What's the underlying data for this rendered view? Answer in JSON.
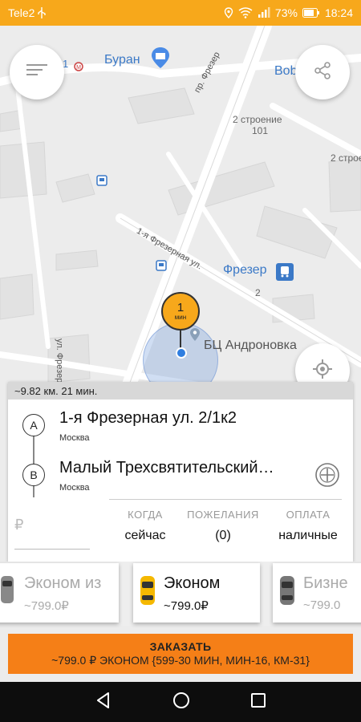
{
  "status": {
    "carrier": "Tele2",
    "battery": "73%",
    "time": "18:24"
  },
  "map": {
    "poi_buran": "Буран",
    "poi_1": "1",
    "poi_bob": "Bob",
    "street_frezer_ave": "пр. Фрезер",
    "building_2_101_line1": "2 строение",
    "building_2_101_line2": "101",
    "building_2_right": "2 строе",
    "street_1st_frezernaya": "1-я Фрезерная ул.",
    "poi_frezer_station": "Фрезер",
    "number_2": "2",
    "street_left": "ул. Фрезер",
    "poi_bc": "БЦ Андроновка",
    "time_marker_value": "1",
    "time_marker_unit": "мин"
  },
  "panel": {
    "route_info": "~9.82 км. 21 мин.",
    "from_letter": "A",
    "from_address": "1-я Фрезерная ул. 2/1к2",
    "from_city": "Москва",
    "to_letter": "B",
    "to_address": "Малый Трехсвятительский…",
    "to_city": "Москва",
    "currency": "₽",
    "when_label": "КОГДА",
    "when_value": "сейчас",
    "wishes_label": "ПОЖЕЛАНИЯ",
    "wishes_value": "(0)",
    "payment_label": "ОПЛАТА",
    "payment_value": "наличные"
  },
  "tariffs": [
    {
      "name": "Эконом из",
      "price": "~799.0₽"
    },
    {
      "name": "Эконом",
      "price": "~799.0₽"
    },
    {
      "name": "Бизне",
      "price": "~799.0"
    }
  ],
  "order": {
    "line1": "ЗАКАЗАТЬ",
    "line2": "~799.0 ₽ ЭКОНОМ {599-30 МИН, МИН-16, КМ-31}"
  },
  "colors": {
    "accent": "#f7a81b",
    "order_button": "#f57f17",
    "location_blue": "#2f7ee0"
  }
}
